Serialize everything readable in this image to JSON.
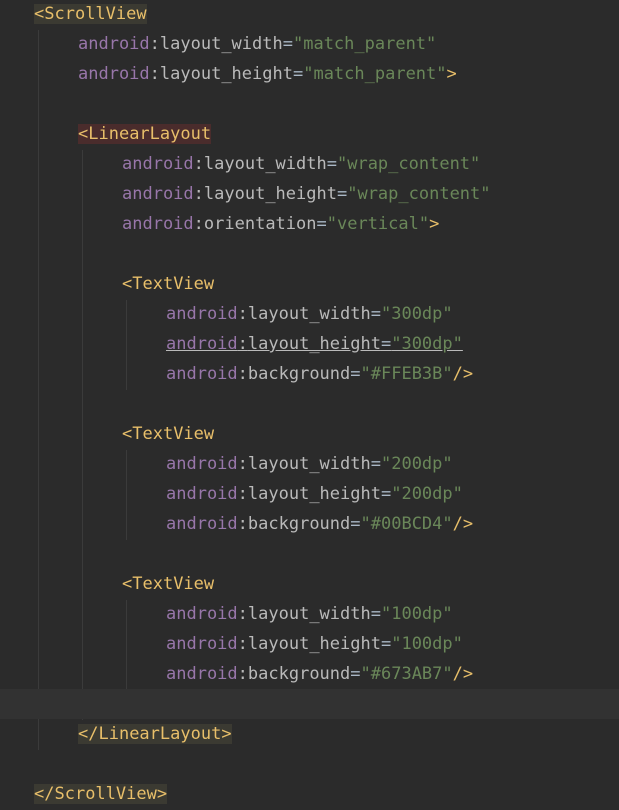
{
  "lines": [
    {
      "indent": 0,
      "kind": "open",
      "tag": "ScrollView",
      "hl": "gold"
    },
    {
      "indent": 1,
      "kind": "attr",
      "ns": "android",
      "name": "layout_width",
      "value": "\"match_parent\""
    },
    {
      "indent": 1,
      "kind": "attr",
      "ns": "android",
      "name": "layout_height",
      "value": "\"match_parent\"",
      "end": ">"
    },
    {
      "kind": "blank"
    },
    {
      "indent": 1,
      "kind": "open",
      "tag": "LinearLayout",
      "hl": "red"
    },
    {
      "indent": 2,
      "kind": "attr",
      "ns": "android",
      "name": "layout_width",
      "value": "\"wrap_content\""
    },
    {
      "indent": 2,
      "kind": "attr",
      "ns": "android",
      "name": "layout_height",
      "value": "\"wrap_content\""
    },
    {
      "indent": 2,
      "kind": "attr",
      "ns": "android",
      "name": "orientation",
      "value": "\"vertical\"",
      "end": ">"
    },
    {
      "kind": "blank"
    },
    {
      "indent": 2,
      "kind": "open",
      "tag": "TextView"
    },
    {
      "indent": 3,
      "kind": "attr",
      "ns": "android",
      "name": "layout_width",
      "value": "\"300dp\""
    },
    {
      "indent": 3,
      "kind": "attr",
      "ns": "android",
      "name": "layout_height",
      "value": "\"300dp\"",
      "underline": true
    },
    {
      "indent": 3,
      "kind": "attr",
      "ns": "android",
      "name": "background",
      "value": "\"#FFEB3B\"",
      "end": "/>"
    },
    {
      "kind": "blank"
    },
    {
      "indent": 2,
      "kind": "open",
      "tag": "TextView"
    },
    {
      "indent": 3,
      "kind": "attr",
      "ns": "android",
      "name": "layout_width",
      "value": "\"200dp\""
    },
    {
      "indent": 3,
      "kind": "attr",
      "ns": "android",
      "name": "layout_height",
      "value": "\"200dp\""
    },
    {
      "indent": 3,
      "kind": "attr",
      "ns": "android",
      "name": "background",
      "value": "\"#00BCD4\"",
      "end": "/>"
    },
    {
      "kind": "blank"
    },
    {
      "indent": 2,
      "kind": "open",
      "tag": "TextView"
    },
    {
      "indent": 3,
      "kind": "attr",
      "ns": "android",
      "name": "layout_width",
      "value": "\"100dp\""
    },
    {
      "indent": 3,
      "kind": "attr",
      "ns": "android",
      "name": "layout_height",
      "value": "\"100dp\""
    },
    {
      "indent": 3,
      "kind": "attr",
      "ns": "android",
      "name": "background",
      "value": "\"#673AB7\"",
      "end": "/>"
    },
    {
      "kind": "blank",
      "current": true
    },
    {
      "indent": 1,
      "kind": "close",
      "tag": "LinearLayout",
      "hl": "gold"
    },
    {
      "kind": "blank"
    },
    {
      "indent": 0,
      "kind": "close",
      "tag": "ScrollView",
      "hl": "gold"
    }
  ],
  "colors": {
    "background": "#2b2b2b",
    "tag": "#e8bf6a",
    "namespace": "#9876aa",
    "attribute": "#bababa",
    "string": "#6a8759",
    "current_line": "#323232"
  }
}
